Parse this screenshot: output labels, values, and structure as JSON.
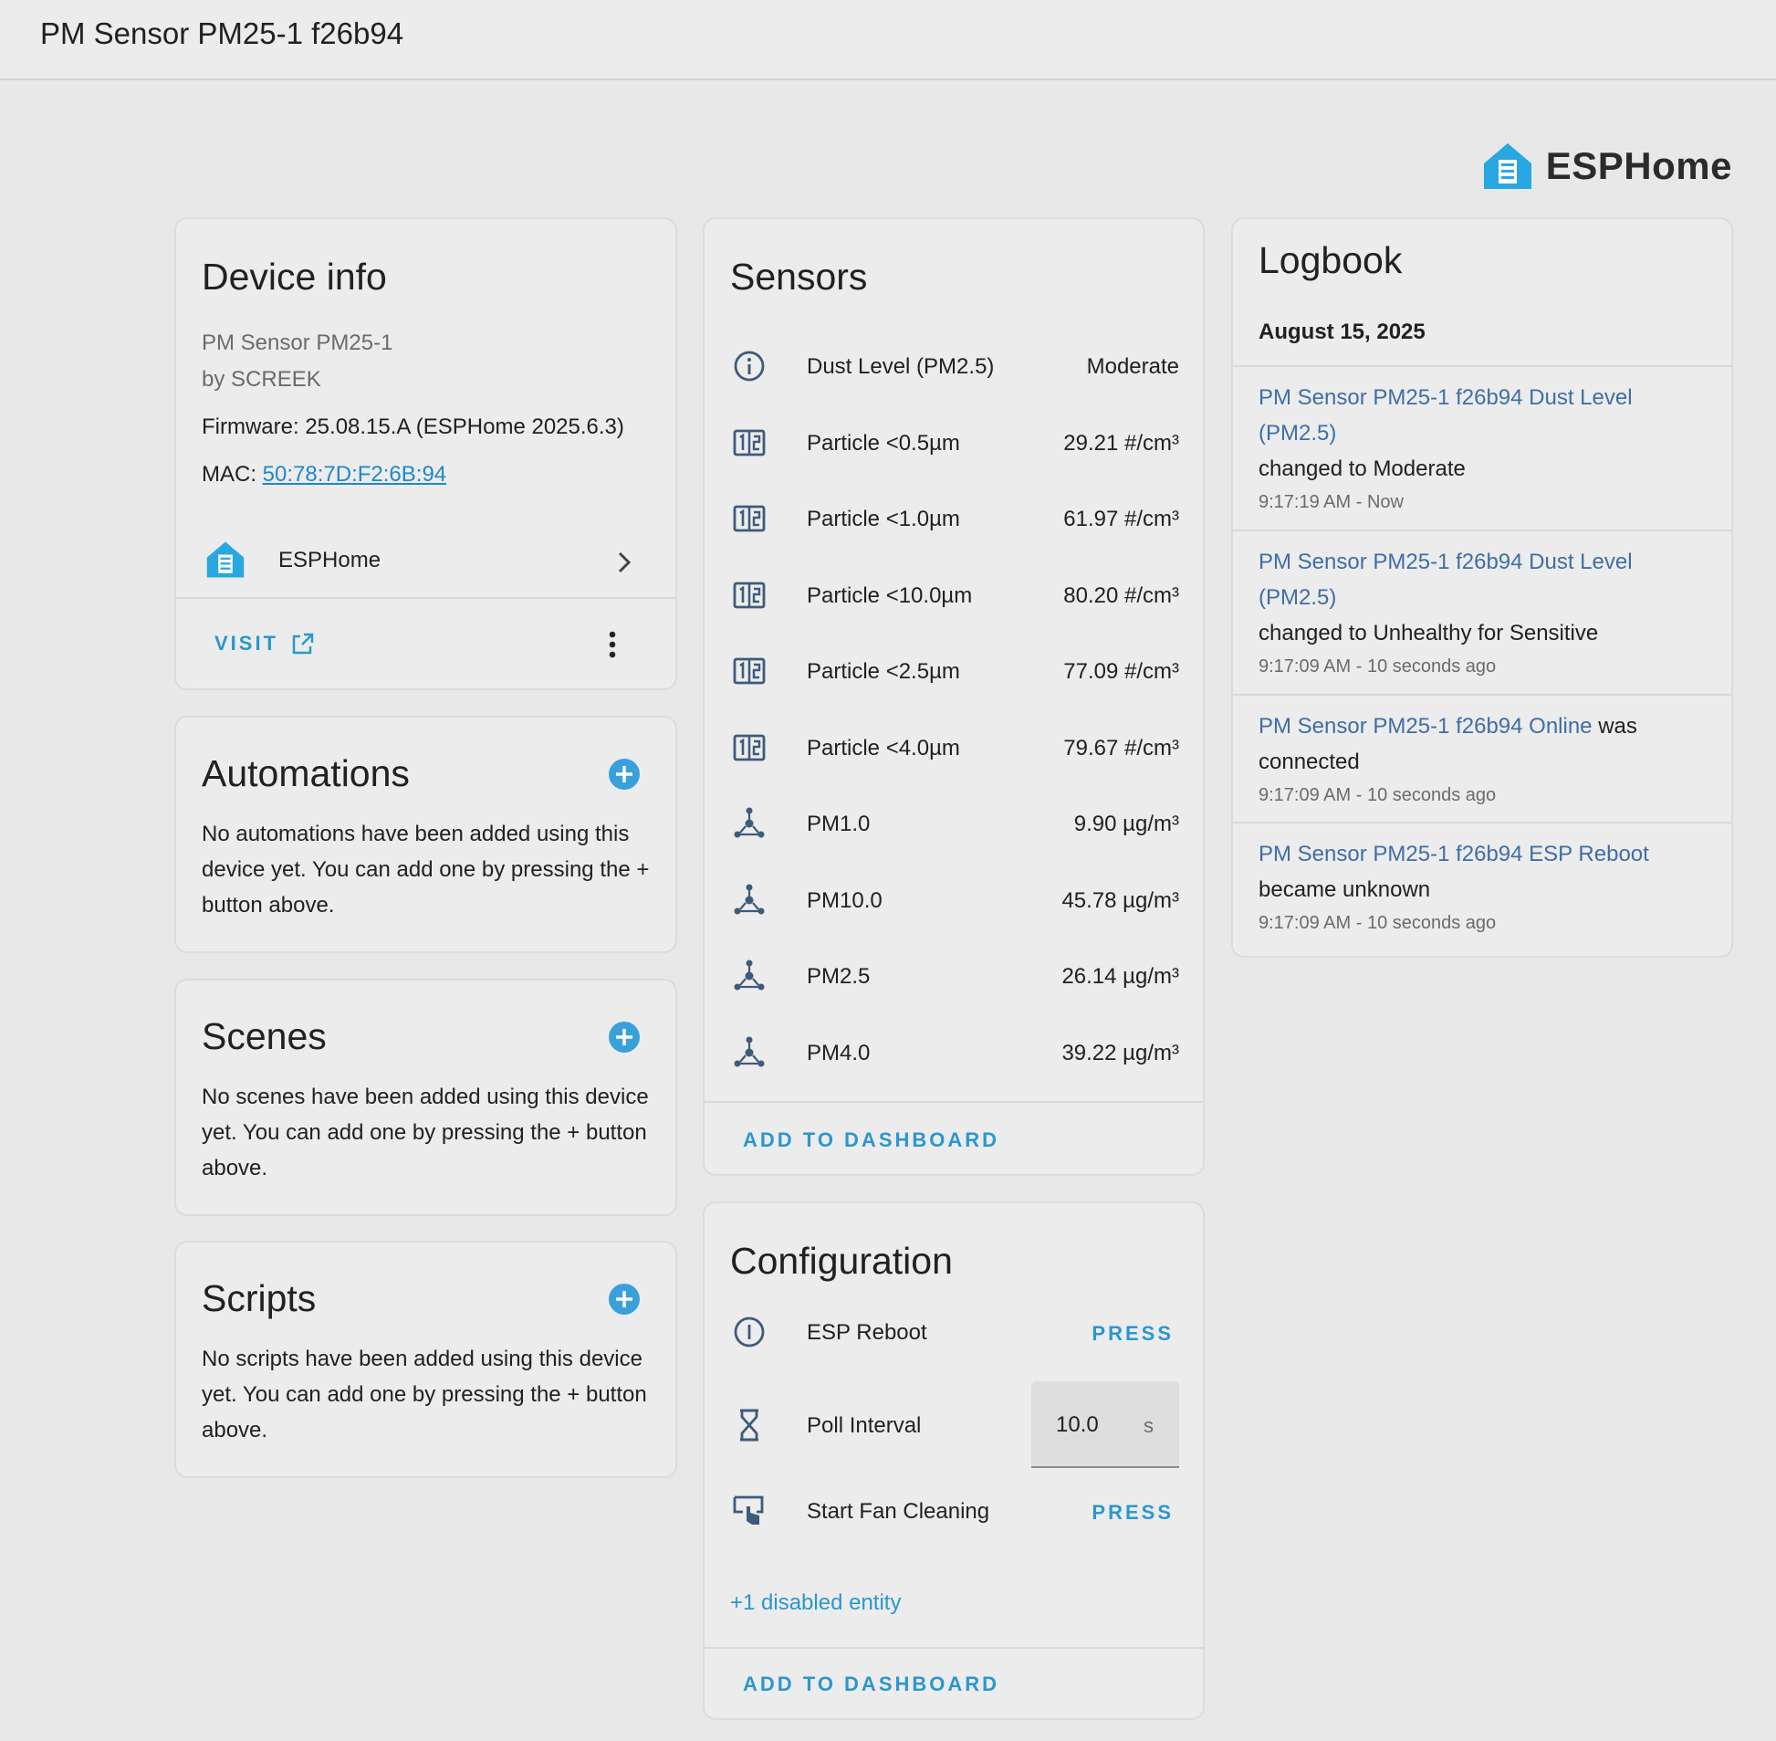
{
  "header": {
    "title": "PM Sensor PM25-1 f26b94"
  },
  "brand": {
    "name": "ESPHome",
    "color": "#29a7e1"
  },
  "device_info": {
    "title": "Device info",
    "model": "PM Sensor PM25-1",
    "manufacturer": "by SCREEK",
    "firmware": "Firmware: 25.08.15.A (ESPHome 2025.6.3)",
    "mac_label": "MAC: ",
    "mac_value": "50:78:7D:F2:6B:94",
    "integration": "ESPHome",
    "visit_label": "VISIT"
  },
  "automations": {
    "title": "Automations",
    "description": "No automations have been added using this device yet. You can add one by pressing the + button above."
  },
  "scenes": {
    "title": "Scenes",
    "description": "No scenes have been added using this device yet. You can add one by pressing the + button above."
  },
  "scripts": {
    "title": "Scripts",
    "description": "No scripts have been added using this device yet. You can add one by pressing the + button above."
  },
  "sensors": {
    "title": "Sensors",
    "items": [
      {
        "name": "Dust Level (PM2.5)",
        "value": "Moderate",
        "icon": "info-icon"
      },
      {
        "name": "Particle <0.5µm",
        "value": "29.21 #/cm³",
        "icon": "counter-icon"
      },
      {
        "name": "Particle <1.0µm",
        "value": "61.97 #/cm³",
        "icon": "counter-icon"
      },
      {
        "name": "Particle <10.0µm",
        "value": "80.20 #/cm³",
        "icon": "counter-icon"
      },
      {
        "name": "Particle <2.5µm",
        "value": "77.09 #/cm³",
        "icon": "counter-icon"
      },
      {
        "name": "Particle <4.0µm",
        "value": "79.67 #/cm³",
        "icon": "counter-icon"
      },
      {
        "name": "PM1.0",
        "value": "9.90 µg/m³",
        "icon": "molecule-icon"
      },
      {
        "name": "PM10.0",
        "value": "45.78 µg/m³",
        "icon": "molecule-icon"
      },
      {
        "name": "PM2.5",
        "value": "26.14 µg/m³",
        "icon": "molecule-icon"
      },
      {
        "name": "PM4.0",
        "value": "39.22 µg/m³",
        "icon": "molecule-icon"
      }
    ],
    "add_to_dashboard": "ADD TO DASHBOARD"
  },
  "configuration": {
    "title": "Configuration",
    "esp_reboot": {
      "name": "ESP Reboot",
      "action": "PRESS",
      "icon": "power-icon"
    },
    "poll_interval": {
      "name": "Poll Interval",
      "value": "10.0",
      "unit": "s",
      "icon": "hourglass-icon"
    },
    "fan_cleaning": {
      "name": "Start Fan Cleaning",
      "action": "PRESS",
      "icon": "gesture-tap-icon"
    },
    "disabled_entities": "+1 disabled entity",
    "add_to_dashboard": "ADD TO DASHBOARD"
  },
  "logbook": {
    "title": "Logbook",
    "date": "August 15, 2025",
    "entries": [
      {
        "entity": "PM Sensor PM25-1 f26b94 Dust Level (PM2.5)",
        "message": "changed to Moderate",
        "time": "9:17:19 AM - Now"
      },
      {
        "entity": "PM Sensor PM25-1 f26b94 Dust Level (PM2.5)",
        "message": "changed to Unhealthy for Sensitive",
        "time": "9:17:09 AM - 10 seconds ago"
      },
      {
        "entity": "PM Sensor PM25-1 f26b94 Online",
        "message": "was connected",
        "time": "9:17:09 AM - 10 seconds ago"
      },
      {
        "entity": "PM Sensor PM25-1 f26b94 ESP Reboot",
        "message": "became unknown",
        "time": "9:17:09 AM - 10 seconds ago"
      }
    ]
  },
  "colors": {
    "accent": "#2a97cf",
    "icon": "#3f5a7a",
    "log_link": "#3f6ea5"
  }
}
